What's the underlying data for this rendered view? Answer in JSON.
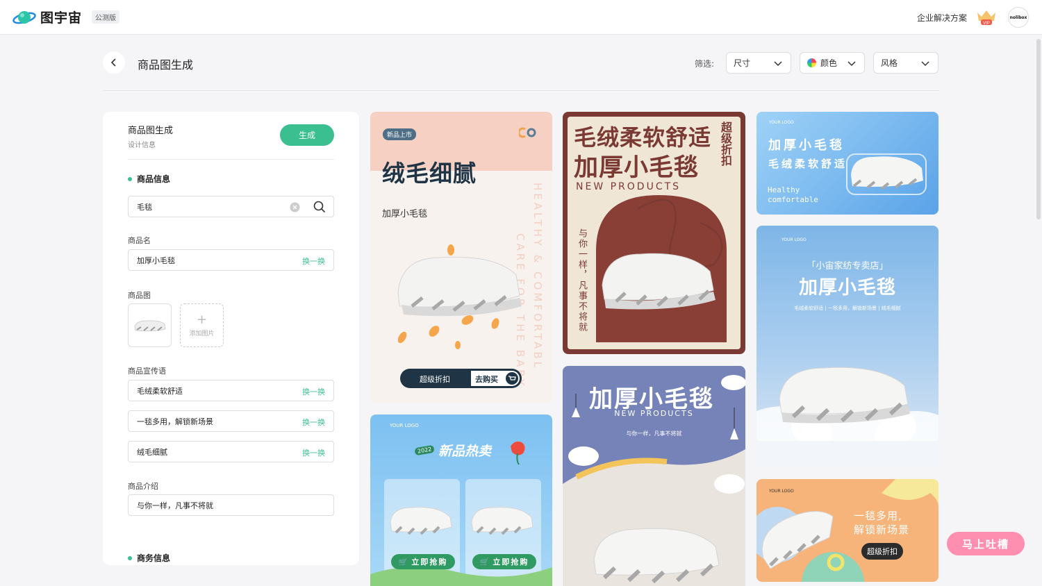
{
  "header": {
    "brand": "图宇宙",
    "beta_badge": "公测版",
    "enterprise_link": "企业解决方案",
    "vip_label": "VIP",
    "avatar_text": "nolibox"
  },
  "page": {
    "title": "商品图生成",
    "filter_label": "筛选:",
    "filters": {
      "size": "尺寸",
      "color": "颜色",
      "style": "风格"
    }
  },
  "form": {
    "title": "商品图生成",
    "subtitle": "设计信息",
    "generate_label": "生成",
    "product_info_heading": "商品信息",
    "search_value": "毛毯",
    "name_label": "商品名",
    "name_value": "加厚小毛毯",
    "swap_label": "换一换",
    "image_label": "商品图",
    "add_image_label": "添加图片",
    "slogan_label": "商品宣传语",
    "slogans": [
      "毛绒柔软舒适",
      "一毯多用，解锁新场景",
      "绒毛细腻"
    ],
    "intro_label": "商品介绍",
    "intro_value": "与你一样，凡事不将就",
    "business_heading": "商务信息"
  },
  "cards": {
    "c1": {
      "badge": "新品上市",
      "headline": "绒毛细腻",
      "sub": "加厚小毛毯",
      "vert1": "HEALTHY & COMFORTABL",
      "vert2": "CARE FOR THE BABY",
      "cta_left": "超级折扣",
      "cta_right": "去购买"
    },
    "c2": {
      "headline1": "毛绒柔软舒适",
      "headline2": "加厚小毛毯",
      "side": "超级折扣",
      "products": "NEW PRODUCTS",
      "vertical": "与你一样，凡事不将就"
    },
    "c3": {
      "logo": "YOUR LOGO",
      "line1": "加厚小毛毯",
      "line2": "毛绒柔软舒适",
      "eng1": "Healthy",
      "eng2": "comfortable"
    },
    "c4": {
      "logo": "YOUR LOGO",
      "shop": "「小宙家纺专卖店」",
      "headline": "加厚小毛毯",
      "sub": "毛绒柔软舒适 | 一毯多用，解锁新场景 | 绒毛细腻"
    },
    "c5": {
      "logo": "YOUR LOGO",
      "year": "2022",
      "headline": "新品热卖",
      "buy1": "立即抢购",
      "buy2": "立即抢购"
    },
    "c6": {
      "headline": "加厚小毛毯",
      "products": "NEW PRODUCTS",
      "sub": "与你一样，凡事不将就"
    },
    "c7": {
      "logo": "YOUR LOGO",
      "line1": "一毯多用,",
      "line2": "解锁新场景",
      "cta": "超级折扣"
    }
  },
  "feedback_button": "马上吐槽",
  "colors": {
    "accent": "#3bbf91",
    "pink": "#ff8fb0"
  }
}
